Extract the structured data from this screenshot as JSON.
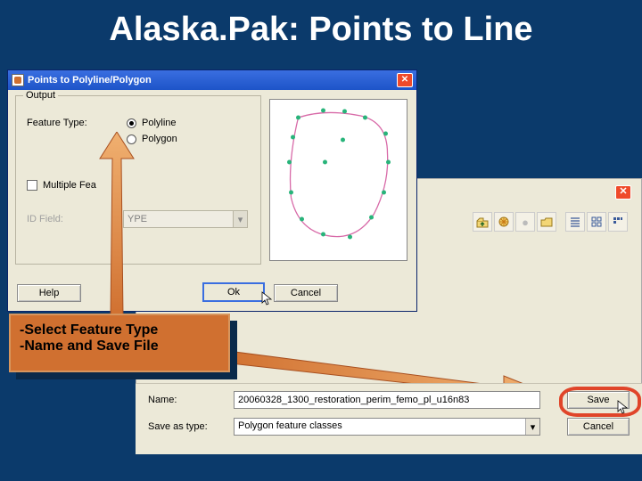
{
  "title": "Alaska.Pak:  Points to Line",
  "dlg": {
    "title": "Points to Polyline/Polygon",
    "output_legend": "Output",
    "feature_type_label": "Feature Type:",
    "polyline": "Polyline",
    "polygon": "Polygon",
    "multi": "Multiple Fea",
    "id_field_label": "ID Field:",
    "id_field_value": "YPE",
    "help": "Help",
    "ok": "Ok",
    "cancel": "Cancel"
  },
  "callout": {
    "line1": "-Select Feature Type",
    "line2": "-Name and Save File"
  },
  "save": {
    "name_label": "Name:",
    "name_value": "20060328_1300_restoration_perim_femo_pl_u16n83",
    "type_label": "Save as type:",
    "type_value": "Polygon feature classes",
    "save_btn": "Save",
    "cancel_btn": "Cancel"
  },
  "icons": {
    "up": "⇧",
    "new": "✳",
    "print": "●",
    "folder": "📁",
    "list": "≣",
    "details": "▦",
    "thumbs": "⊞"
  }
}
